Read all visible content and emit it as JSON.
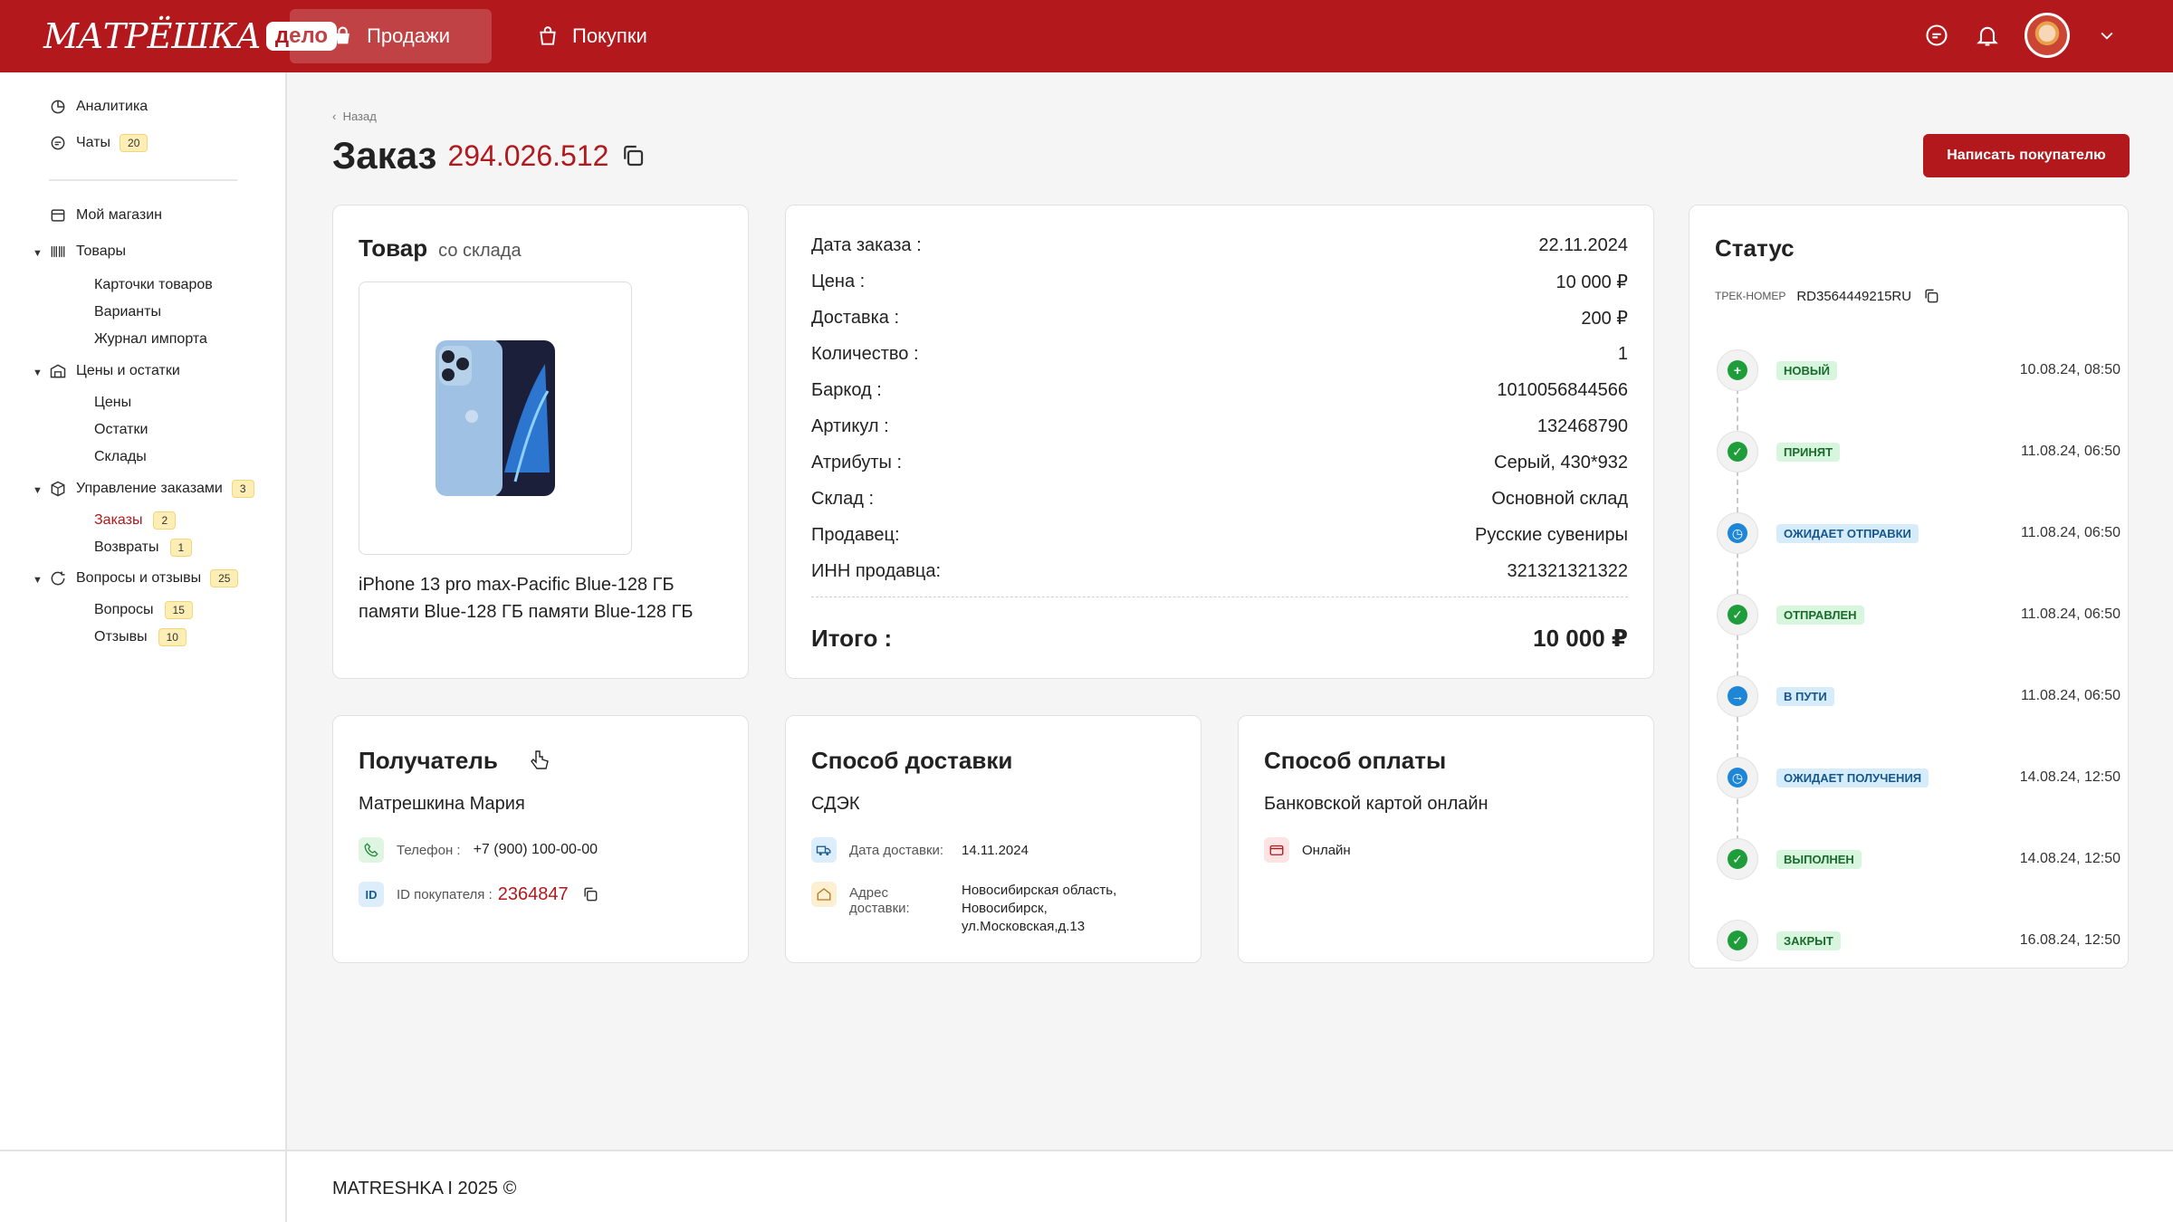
{
  "topbar": {
    "logo_word": "МАТРЁШКА",
    "logo_badge": "дело",
    "tabs": [
      {
        "label": "Продажи"
      },
      {
        "label": "Покупки"
      }
    ],
    "accent": "#b3191c"
  },
  "sidebar": {
    "analytics": "Аналитика",
    "chats": "Чаты",
    "chats_badge": "20",
    "my_shop": "Мой магазин",
    "goods": "Товары",
    "goods_items": [
      "Карточки товаров",
      "Варианты",
      "Журнал импорта"
    ],
    "prices": "Цены и остатки",
    "prices_items": [
      "Цены",
      "Остатки",
      "Склады"
    ],
    "orders_mgmt": "Управление заказами",
    "orders_mgmt_badge": "3",
    "orders": "Заказы",
    "orders_badge": "2",
    "returns": "Возвраты",
    "returns_badge": "1",
    "qa": "Вопросы и отзывы",
    "qa_badge": "25",
    "questions": "Вопросы",
    "questions_badge": "15",
    "reviews": "Отзывы",
    "reviews_badge": "10"
  },
  "header": {
    "back": "Назад",
    "title": "Заказ",
    "order_number": "294.026.512",
    "write_button": "Написать покупателю"
  },
  "product": {
    "title": "Товар",
    "subtitle": "со склада",
    "name": "iPhone 13 pro max-Pacific Blue-128 ГБ памяти Blue-128 ГБ памяти Blue-128 ГБ"
  },
  "details": {
    "rows": [
      {
        "label": "Дата заказа :",
        "value": "22.11.2024"
      },
      {
        "label": "Цена :",
        "value": "10 000 ₽"
      },
      {
        "label": "Доставка :",
        "value": "200 ₽"
      },
      {
        "label": "Количество :",
        "value": "1"
      },
      {
        "label": "Баркод :",
        "value": "1010056844566"
      },
      {
        "label": "Артикул :",
        "value": "132468790"
      },
      {
        "label": "Атрибуты :",
        "value": "Серый, 430*932"
      },
      {
        "label": "Склад :",
        "value": "Основной склад"
      },
      {
        "label": "Продавец:",
        "value": "Русские сувениры"
      },
      {
        "label": "ИНН продавца:",
        "value": "321321321322"
      }
    ],
    "total_label": "Итого :",
    "total_value": "10 000 ₽"
  },
  "recipient": {
    "title": "Получатель",
    "name": "Матрешкина Мария",
    "phone_label": "Телефон :",
    "phone": "+7 (900) 100-00-00",
    "id_icon": "ID",
    "id_label": "ID покупателя :",
    "id_value": "2364847"
  },
  "delivery": {
    "title": "Способ доставки",
    "method": "СДЭК",
    "date_label": "Дата доставки:",
    "date": "14.11.2024",
    "address_label": "Адрес доставки:",
    "address_lines": [
      "Новосибирская область,",
      "Новосибирск,",
      "ул.Московская,д.13"
    ]
  },
  "payment": {
    "title": "Способ оплаты",
    "method": "Банковской картой онлайн",
    "type": "Онлайн"
  },
  "status": {
    "title": "Статус",
    "track_label": "ТРЕК-НОМЕР",
    "track_number": "RD3564449215RU",
    "items": [
      {
        "label": "Новый",
        "time": "10.08.24, 08:50",
        "kind": "new"
      },
      {
        "label": "Принят",
        "time": "11.08.24, 06:50",
        "kind": "done"
      },
      {
        "label": "Ожидает отправки",
        "time": "11.08.24, 06:50",
        "kind": "wait"
      },
      {
        "label": "Отправлен",
        "time": "11.08.24, 06:50",
        "kind": "done"
      },
      {
        "label": "В пути",
        "time": "11.08.24, 06:50",
        "kind": "move"
      },
      {
        "label": "Ожидает получения",
        "time": "14.08.24, 12:50",
        "kind": "wait"
      },
      {
        "label": "Выполнен",
        "time": "14.08.24, 12:50",
        "kind": "done"
      },
      {
        "label": "Закрыт",
        "time": "16.08.24, 12:50",
        "kind": "done"
      }
    ]
  },
  "footer": {
    "text": "MATRESHKA I 2025 ©"
  }
}
